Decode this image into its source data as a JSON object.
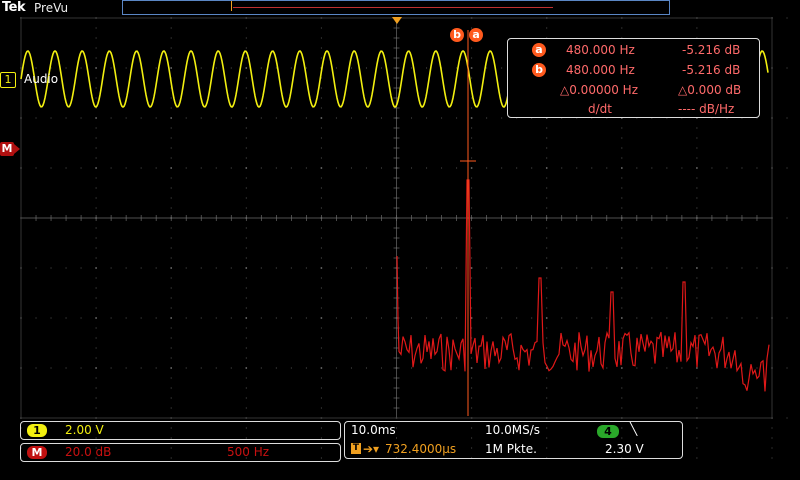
{
  "header": {
    "brand": "Tek",
    "mode": "PreVu"
  },
  "trigger_marker": "▼",
  "channels": {
    "ch1": {
      "number": "1",
      "name": "Audio",
      "color": "#f2ef10"
    },
    "math": {
      "label": "M",
      "color": "#d01010"
    }
  },
  "cursors": {
    "a_badge": "a",
    "b_badge": "b",
    "readout": {
      "a": {
        "freq": "480.000 Hz",
        "mag": "-5.216 dB"
      },
      "b": {
        "freq": "480.000 Hz",
        "mag": "-5.216 dB"
      },
      "delta": {
        "freq": "△0.00000 Hz",
        "mag": "△0.000 dB"
      },
      "ddt": {
        "label": "d/dt",
        "value": "---- dB/Hz"
      }
    }
  },
  "bottom": {
    "ch1_scale": {
      "badge": "1",
      "value": "2.00 V"
    },
    "math_scale": {
      "badge": "M",
      "value": "20.0 dB",
      "span": "500 Hz"
    },
    "timebase": {
      "time_div": "10.0ms",
      "sample_rate": "10.0MS/s",
      "trigger_pos": "732.4000µs",
      "record_len": "1M Pkte."
    },
    "trigger": {
      "source_badge": "4",
      "slope_icon": "╲",
      "level": "2.30 V"
    }
  },
  "colors": {
    "ch1": "#f2ef10",
    "math": "#e01818",
    "cursor": "#ff5a1e",
    "grid": "#6a6a6a",
    "overview": "#5a86c4"
  }
}
